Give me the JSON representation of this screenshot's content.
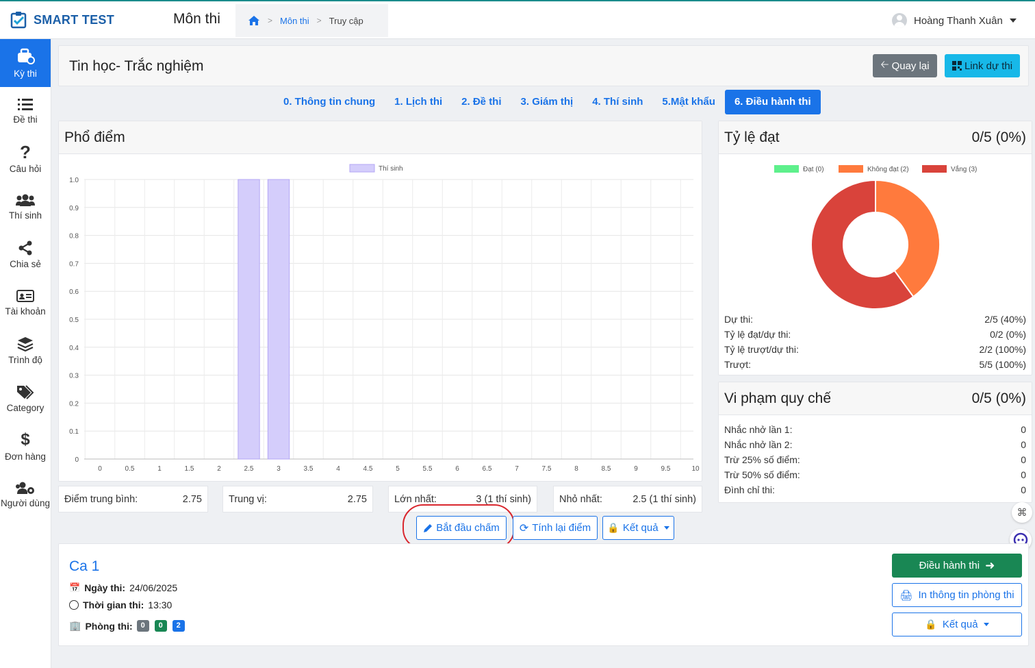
{
  "app": {
    "name": "SMART TEST",
    "section_title": "Môn thi"
  },
  "breadcrumb": {
    "home_icon": "home-icon",
    "items": [
      "Môn thi",
      "Truy cập"
    ]
  },
  "user": {
    "name": "Hoàng Thanh Xuân"
  },
  "sidebar": {
    "items": [
      {
        "label": "Kỳ thi",
        "icon": "exam-icon",
        "active": true
      },
      {
        "label": "Đề thi",
        "icon": "list-icon"
      },
      {
        "label": "Câu hỏi",
        "icon": "question-icon"
      },
      {
        "label": "Thí sinh",
        "icon": "users-icon"
      },
      {
        "label": "Chia sẻ",
        "icon": "share-icon"
      },
      {
        "label": "Tài khoản",
        "icon": "id-card-icon"
      },
      {
        "label": "Trình độ",
        "icon": "layers-icon"
      },
      {
        "label": "Category",
        "icon": "tags-icon"
      },
      {
        "label": "Đơn hàng",
        "icon": "dollar-icon"
      },
      {
        "label": "Người dùng",
        "icon": "users-cog-icon"
      }
    ]
  },
  "header": {
    "title": "Tin học- Trắc nghiệm",
    "back_label": "Quay lại",
    "link_label": "Link dự thi"
  },
  "tabs": [
    "0. Thông tin chung",
    "1. Lịch thi",
    "2. Đề thi",
    "3. Giám thị",
    "4. Thí sinh",
    "5.Mật khẩu",
    "6. Điều hành thi"
  ],
  "score_dist": {
    "title": "Phổ điểm"
  },
  "chart_data": {
    "type": "bar",
    "title": "",
    "legend": [
      "Thí sinh"
    ],
    "categories": [
      "0",
      "0.5",
      "1",
      "1.5",
      "2",
      "2.5",
      "3",
      "3.5",
      "4",
      "4.5",
      "5",
      "5.5",
      "6",
      "6.5",
      "7",
      "7.5",
      "8",
      "8.5",
      "9",
      "9.5",
      "10"
    ],
    "series": [
      {
        "name": "Thí sinh",
        "values": [
          0,
          0,
          0,
          0,
          0,
          1,
          1,
          0,
          0,
          0,
          0,
          0,
          0,
          0,
          0,
          0,
          0,
          0,
          0,
          0,
          0
        ]
      }
    ],
    "ylim": [
      0,
      1.0
    ],
    "yticks": [
      "1.0",
      "0.9",
      "0.8",
      "0.7",
      "0.6",
      "0.5",
      "0.4",
      "0.3",
      "0.2",
      "0.1",
      "0"
    ],
    "grid": true,
    "legend_position": "top",
    "color": "#d4cdfb"
  },
  "stats": [
    {
      "label": "Điểm trung bình:",
      "value": "2.75"
    },
    {
      "label": "Trung vị:",
      "value": "2.75"
    },
    {
      "label": "Lớn nhất:",
      "value": "3 (1 thí sinh)"
    },
    {
      "label": "Nhỏ nhất:",
      "value": "2.5 (1 thí sinh)"
    }
  ],
  "actions": {
    "start_grading": "Bắt đầu chấm",
    "recalc": "Tính lại điểm",
    "results": "Kết quả"
  },
  "pass_rate": {
    "title": "Tỷ lệ đạt",
    "value": "0/5 (0%)",
    "donut": {
      "legend": [
        {
          "label": "Đạt (0)",
          "value": 0,
          "color": "#5ef08c"
        },
        {
          "label": "Không đạt (2)",
          "value": 2,
          "color": "#ff7a3d"
        },
        {
          "label": "Vắng (3)",
          "value": 3,
          "color": "#d9433b"
        }
      ]
    },
    "rows": [
      {
        "label": "Dự thi:",
        "value": "2/5 (40%)"
      },
      {
        "label": "Tỷ lệ đạt/dự thi:",
        "value": "0/2 (0%)"
      },
      {
        "label": "Tỷ lệ trượt/dự thi:",
        "value": "2/2 (100%)"
      },
      {
        "label": "Trượt:",
        "value": "5/5 (100%)"
      }
    ]
  },
  "violations": {
    "title": "Vi phạm quy chế",
    "value": "0/5 (0%)",
    "rows": [
      {
        "label": "Nhắc nhở lần 1:",
        "value": "0"
      },
      {
        "label": "Nhắc nhở lần 2:",
        "value": "0"
      },
      {
        "label": "Trừ 25% số điểm:",
        "value": "0"
      },
      {
        "label": "Trừ 50% số điểm:",
        "value": "0"
      },
      {
        "label": "Đình chỉ thi:",
        "value": "0"
      }
    ]
  },
  "session": {
    "title": "Ca 1",
    "date_label": "Ngày thi:",
    "date": "24/06/2025",
    "time_label": "Thời gian thi:",
    "time": "13:30",
    "room_label": "Phòng thi:",
    "badges": [
      {
        "value": "0",
        "color": "#6c757d"
      },
      {
        "value": "0",
        "color": "#198754"
      },
      {
        "value": "2",
        "color": "#1a73e8"
      }
    ],
    "control_label": "Điều hành thi",
    "print_label": "In thông tin phòng thi",
    "results_label": "Kết quả"
  }
}
